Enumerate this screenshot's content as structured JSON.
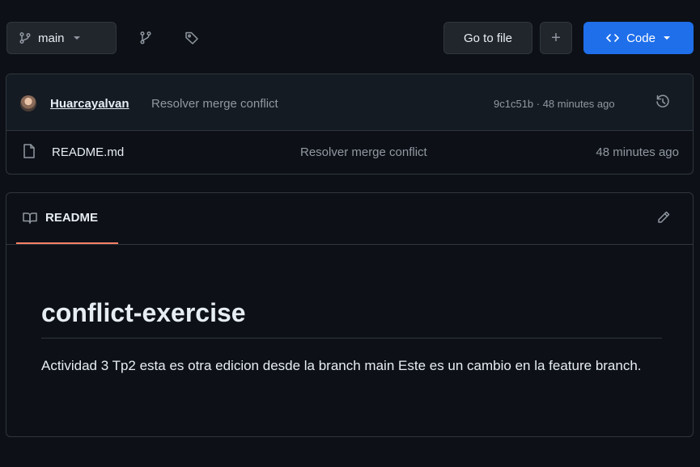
{
  "toolbar": {
    "branch_label": "main",
    "goto_label": "Go to file",
    "plus_label": "+",
    "code_label": "Code",
    "icons": [
      "git-branch-icon",
      "caret-down-icon",
      "branches-icon",
      "tag-icon",
      "code-icon"
    ]
  },
  "commit": {
    "author": "Huarcayalvan",
    "message": "Resolver merge conflict",
    "meta": "9c1c51b · 48 minutes ago"
  },
  "files": [
    {
      "name": "README.md",
      "message": "Resolver merge conflict",
      "time": "48 minutes ago"
    }
  ],
  "readme": {
    "tab_label": "README",
    "title": "conflict-exercise",
    "body": "Actividad 3 Tp2 esta es otra edicion desde la branch main Este es un cambio en la feature branch."
  },
  "colors": {
    "background": "#0d1117",
    "accent_blue": "#1f6feb",
    "tab_underline": "#f78166",
    "border": "#30363d",
    "muted_text": "#9198a1"
  }
}
